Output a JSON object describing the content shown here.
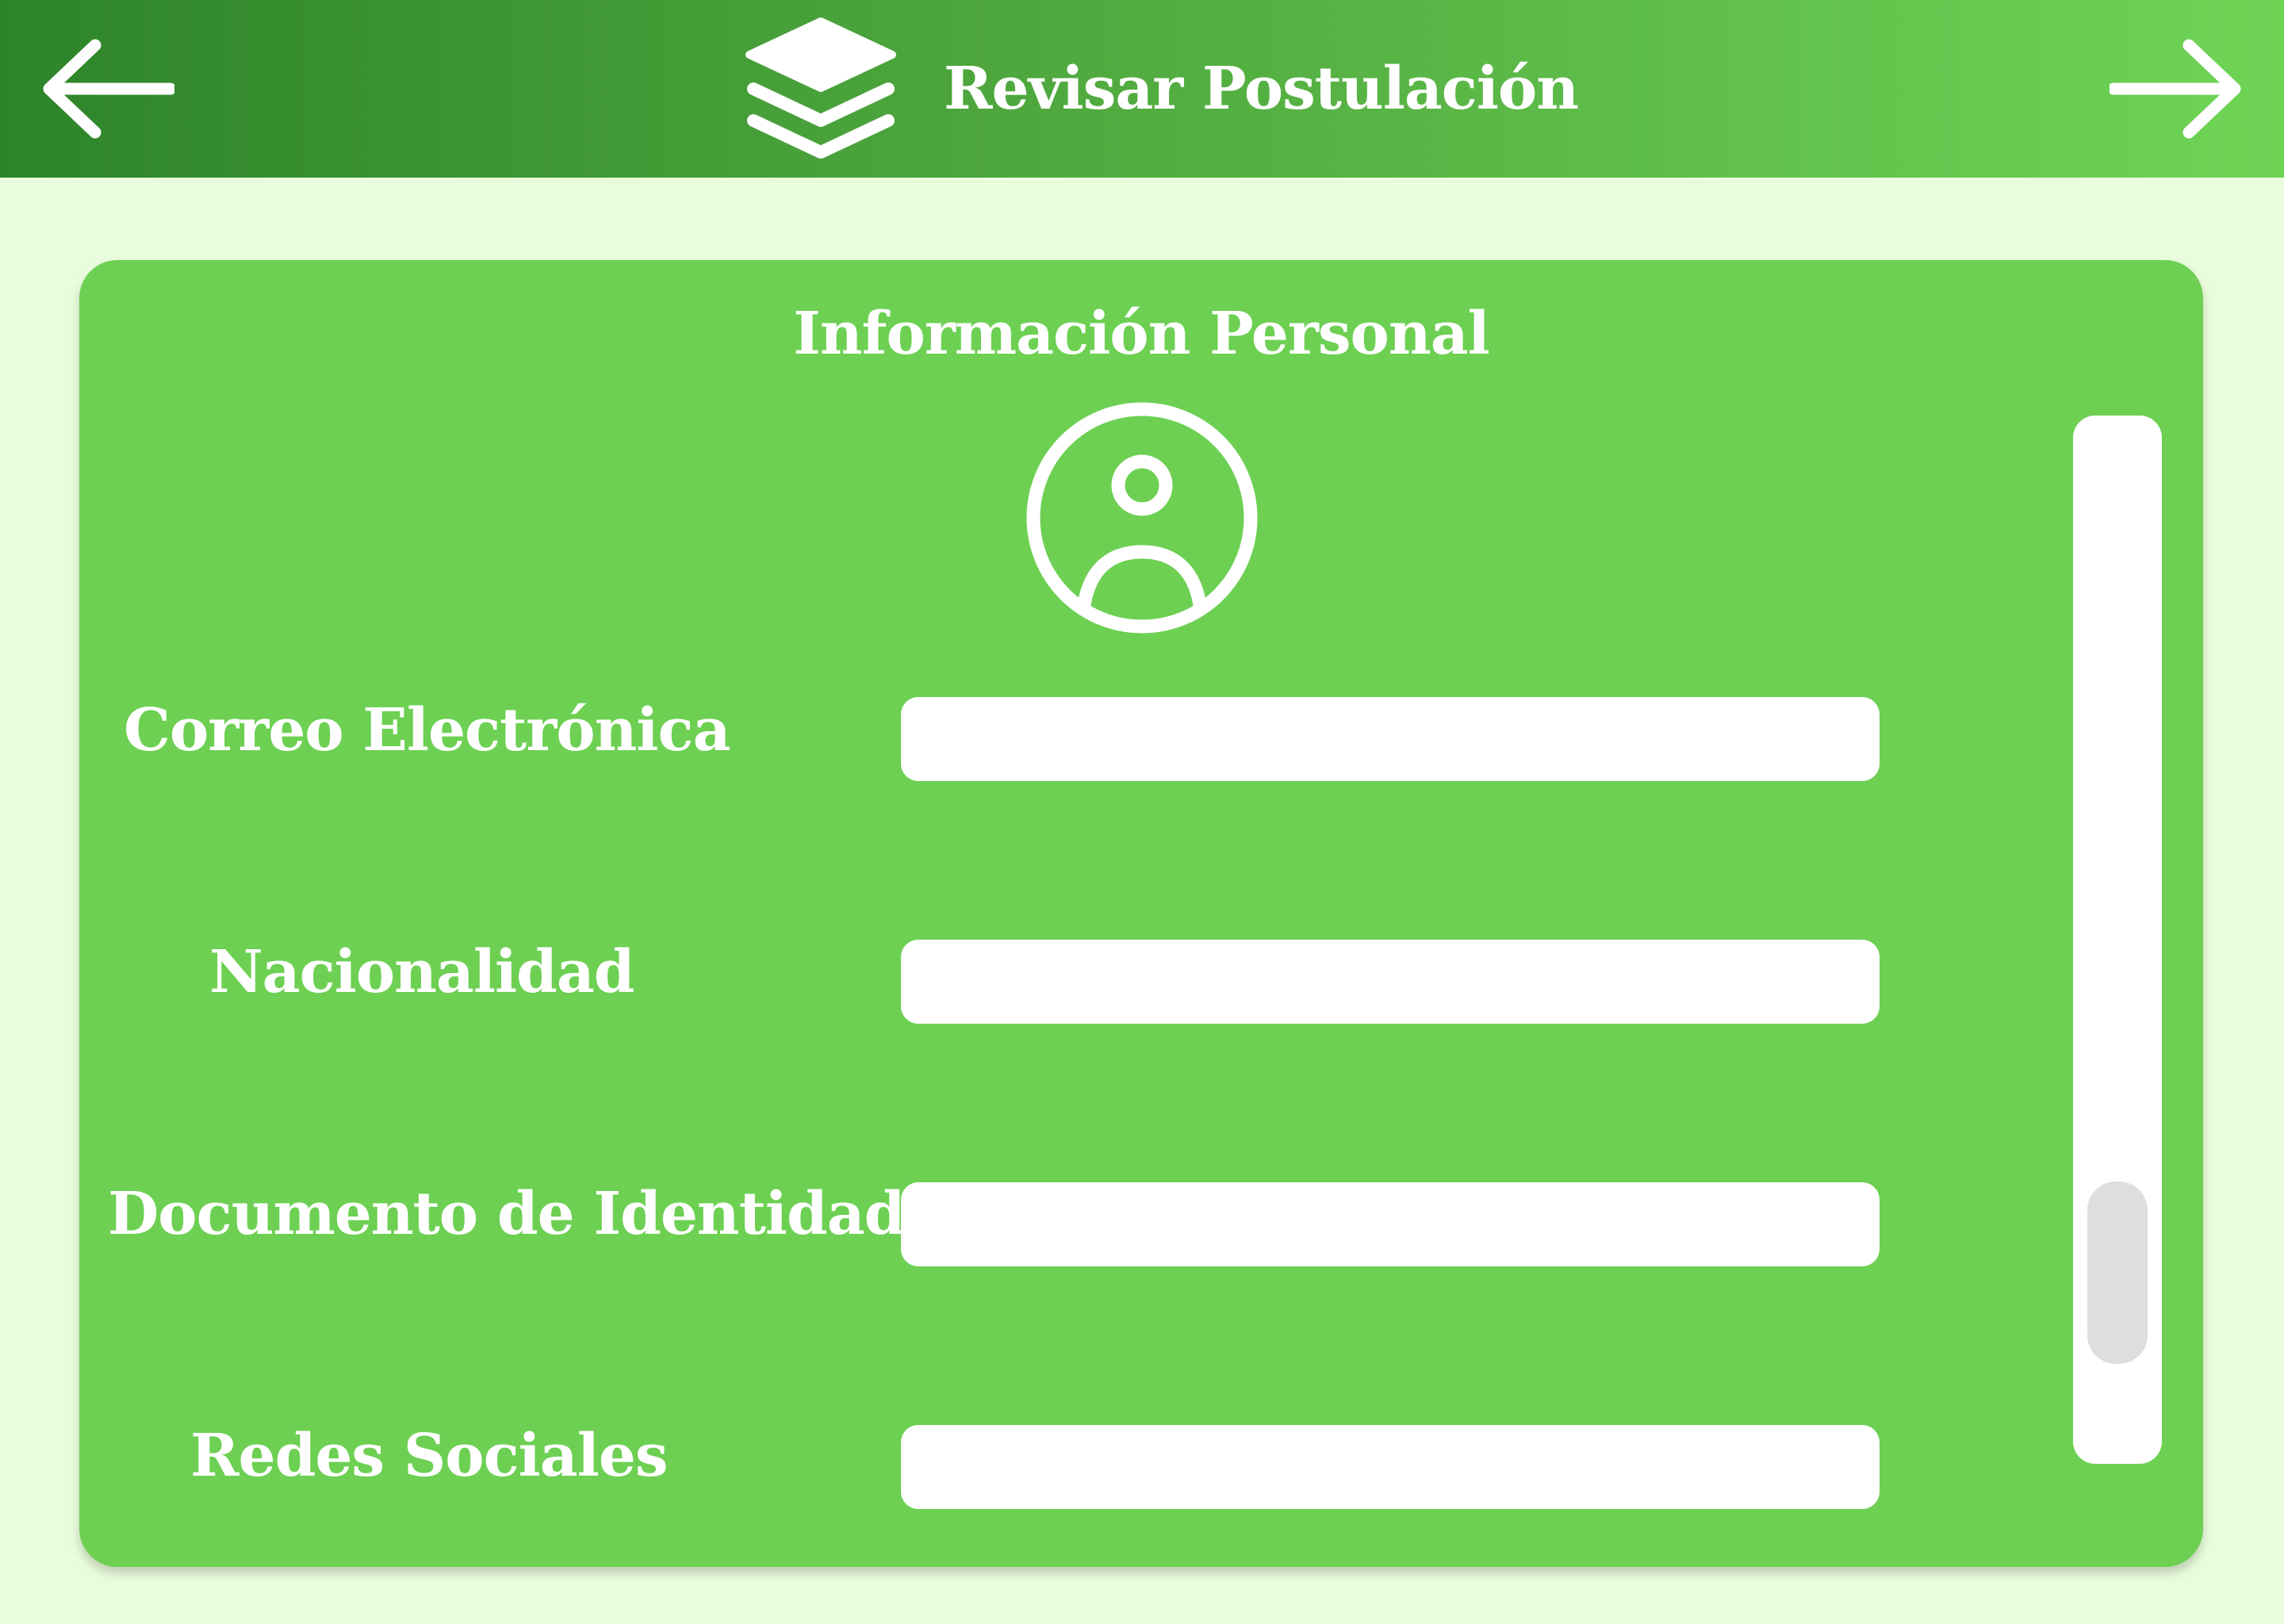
{
  "header": {
    "title": "Revisar Postulación",
    "back_icon": "arrow-left-icon",
    "forward_icon": "arrow-right-icon",
    "title_icon": "layers-icon"
  },
  "section": {
    "title": "Información Personal",
    "avatar_icon": "user-circle-icon"
  },
  "fields": [
    {
      "label": "Correo Electrónica",
      "value": "",
      "placeholder": ""
    },
    {
      "label": "Nacionalidad",
      "value": "",
      "placeholder": ""
    },
    {
      "label": "Documento de Identidad",
      "value": "",
      "placeholder": ""
    },
    {
      "label": "Redes Sociales",
      "value": "",
      "placeholder": ""
    }
  ],
  "colors": {
    "header_dark": "#2E8429",
    "header_light": "#6FD456",
    "page_background": "#E9FCDC",
    "card_background": "#6DD053",
    "field_background": "#FFFFFF",
    "scroll_thumb": "#DEDEDE"
  }
}
